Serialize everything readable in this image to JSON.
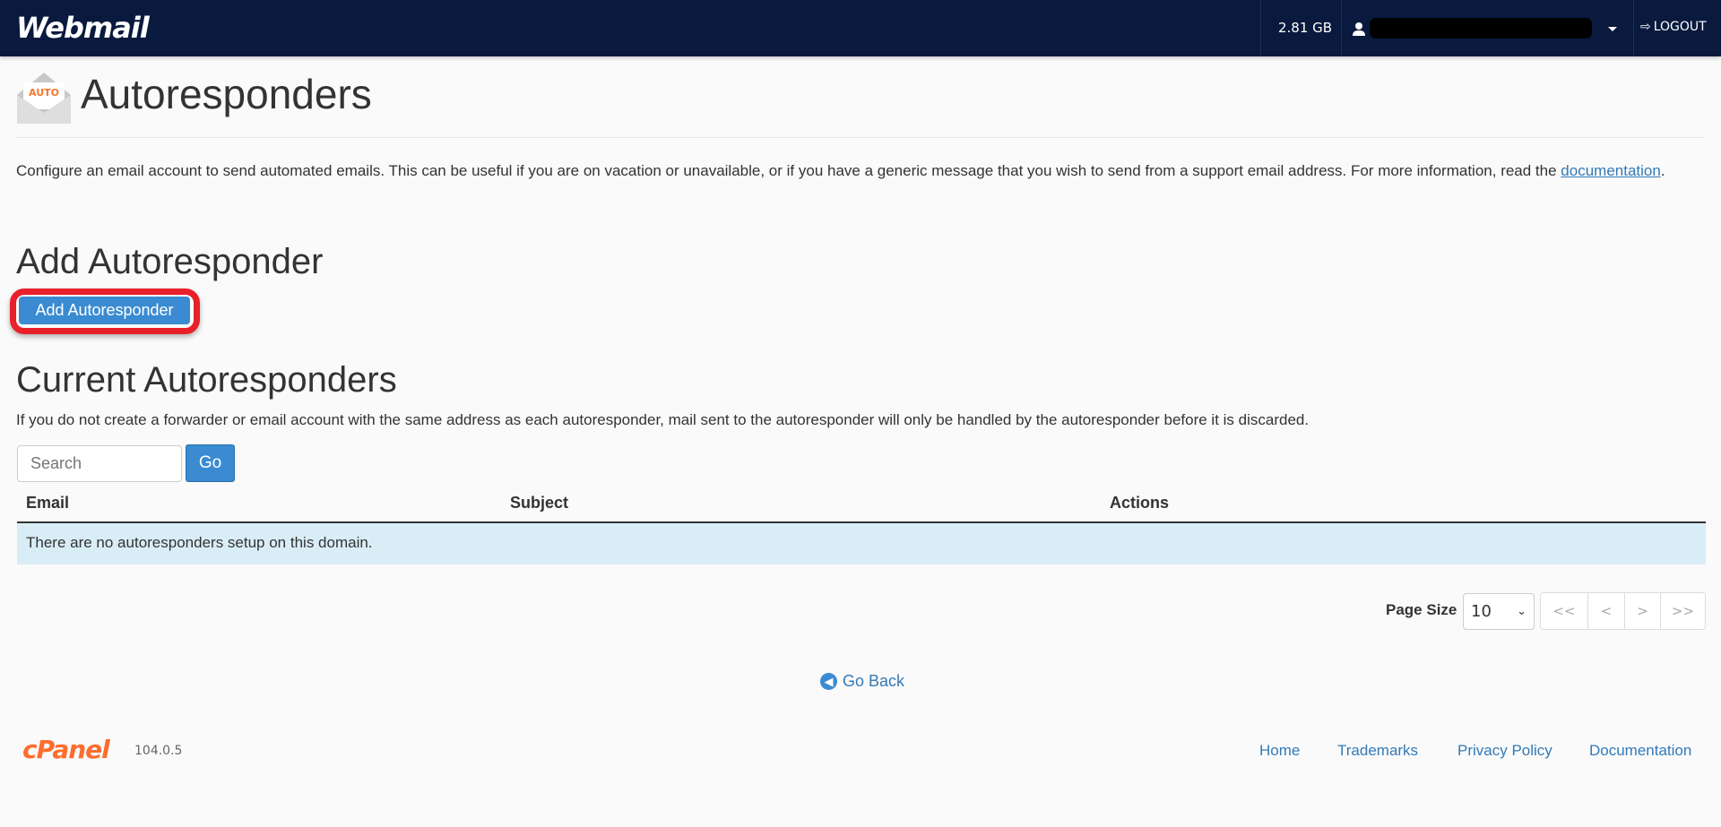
{
  "header": {
    "logo": "Webmail",
    "quota": "2.81 GB",
    "username_redacted": true,
    "logout": "LOGOUT",
    "bg": "#0a1a3e"
  },
  "page": {
    "title": "Autoresponders",
    "icon_label": "AUTO",
    "description": "Configure an email account to send automated emails. This can be useful if you are on vacation or unavailable, or if you have a generic message that you wish to send from a support email address. For more information, read the ",
    "doc_link": "documentation",
    "desc_end": "."
  },
  "add": {
    "heading": "Add Autoresponder",
    "button": "Add Autoresponder"
  },
  "current": {
    "heading": "Current Autoresponders",
    "note": "If you do not create a forwarder or email account with the same address as each autoresponder, mail sent to the autoresponder will only be handled by the autoresponder before it is discarded.",
    "search_placeholder": "Search",
    "go": "Go",
    "columns": [
      "Email",
      "Subject",
      "Actions"
    ],
    "empty": "There are no autoresponders setup on this domain.",
    "page_size_label": "Page Size",
    "page_size": "10",
    "pager": [
      "<<",
      "<",
      ">",
      ">>"
    ]
  },
  "go_back": "Go Back",
  "footer": {
    "brand": "cPanel",
    "version": "104.0.5",
    "links": [
      "Home",
      "Trademarks",
      "Privacy Policy",
      "Documentation"
    ]
  },
  "accent": "#3a8bd1"
}
